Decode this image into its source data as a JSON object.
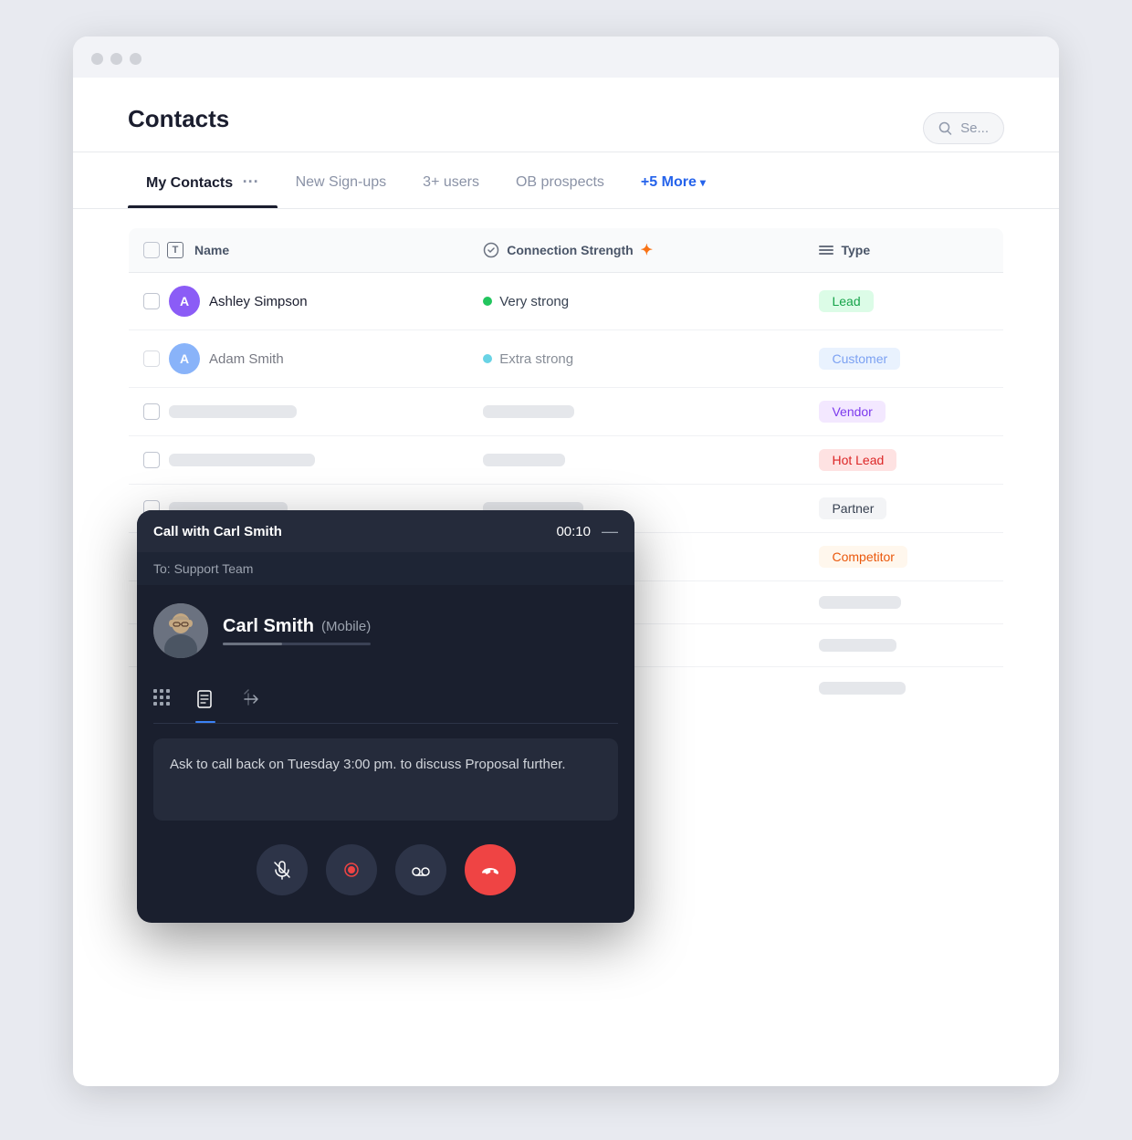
{
  "browser": {
    "dots": [
      "dot1",
      "dot2",
      "dot3"
    ]
  },
  "header": {
    "title": "Contacts",
    "search_placeholder": "Se..."
  },
  "tabs": [
    {
      "id": "my-contacts",
      "label": "My Contacts",
      "active": true
    },
    {
      "id": "new-signups",
      "label": "New Sign-ups",
      "active": false
    },
    {
      "id": "3plus-users",
      "label": "3+ users",
      "active": false
    },
    {
      "id": "ob-prospects",
      "label": "OB prospects",
      "active": false
    },
    {
      "id": "more",
      "label": "+5 More",
      "active": false
    }
  ],
  "table": {
    "columns": [
      {
        "id": "name",
        "label": "Name",
        "icon": "T"
      },
      {
        "id": "connection",
        "label": "Connection Strength"
      },
      {
        "id": "type",
        "label": "Type"
      }
    ],
    "rows": [
      {
        "name": "Ashley Simpson",
        "avatar_letter": "A",
        "avatar_color": "purple",
        "connection": "Very strong",
        "connection_dot": "green",
        "type": "Lead",
        "type_class": "lead"
      },
      {
        "name": "Adam Smith",
        "avatar_letter": "A",
        "avatar_color": "blue",
        "connection": "Extra strong",
        "connection_dot": "teal",
        "type": "Customer",
        "type_class": "customer"
      },
      {
        "name": "",
        "avatar_letter": "",
        "avatar_color": "",
        "connection": "",
        "connection_dot": "",
        "type": "Vendor",
        "type_class": "vendor"
      },
      {
        "name": "",
        "avatar_letter": "",
        "avatar_color": "",
        "connection": "",
        "connection_dot": "",
        "type": "Hot Lead",
        "type_class": "hotlead"
      },
      {
        "name": "",
        "avatar_letter": "",
        "avatar_color": "",
        "connection": "",
        "connection_dot": "",
        "type": "Partner",
        "type_class": "partner"
      },
      {
        "name": "",
        "avatar_letter": "",
        "avatar_color": "",
        "connection": "",
        "connection_dot": "",
        "type": "Competitor",
        "type_class": "competitor"
      },
      {
        "name": "",
        "avatar_letter": "",
        "avatar_color": "",
        "connection": "",
        "connection_dot": "",
        "type": "",
        "type_class": "placeholder"
      },
      {
        "name": "",
        "avatar_letter": "",
        "avatar_color": "",
        "connection": "",
        "connection_dot": "",
        "type": "",
        "type_class": "placeholder"
      },
      {
        "name": "",
        "avatar_letter": "",
        "avatar_color": "",
        "connection": "",
        "connection_dot": "",
        "type": "",
        "type_class": "placeholder"
      }
    ]
  },
  "call_overlay": {
    "title": "Call with Carl Smith",
    "timer": "00:10",
    "to": "To: Support Team",
    "caller_name": "Carl Smith",
    "caller_label": "(Mobile)",
    "tabs": [
      {
        "id": "keypad",
        "label": "keypad",
        "active": false
      },
      {
        "id": "notes",
        "label": "notes",
        "active": true
      },
      {
        "id": "transfer",
        "label": "transfer",
        "active": false
      }
    ],
    "note": "Ask to call back on Tuesday 3:00 pm. to discuss Proposal further.",
    "actions": [
      {
        "id": "mute",
        "label": "Mute"
      },
      {
        "id": "record",
        "label": "Record"
      },
      {
        "id": "voicemail",
        "label": "Voicemail"
      },
      {
        "id": "hangup",
        "label": "Hang up"
      }
    ]
  }
}
